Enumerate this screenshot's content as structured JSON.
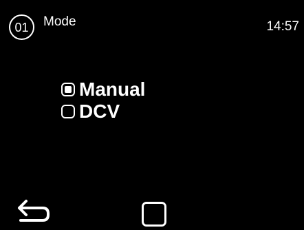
{
  "header": {
    "page_number": "01",
    "title": "Mode",
    "time": "14:57"
  },
  "mode": {
    "options": [
      {
        "label": "Manual",
        "selected": true
      },
      {
        "label": "DCV",
        "selected": false
      }
    ]
  },
  "controls": {
    "back_icon": "back-arrow-icon",
    "home_icon": "home-square-icon"
  },
  "colors": {
    "background": "#000000",
    "foreground": "#ffffff"
  }
}
